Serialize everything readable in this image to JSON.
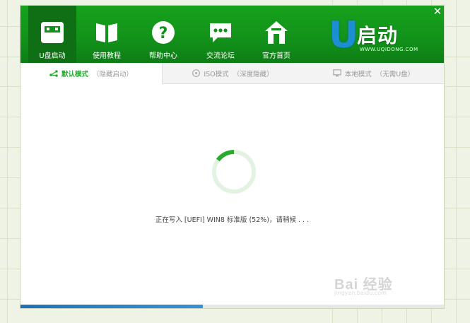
{
  "window": {
    "close_label": "✕"
  },
  "nav": [
    {
      "label": "U盘启动",
      "icon": "usb-drive-icon",
      "active": true
    },
    {
      "label": "使用教程",
      "icon": "book-icon",
      "active": false
    },
    {
      "label": "帮助中心",
      "icon": "question-icon",
      "active": false
    },
    {
      "label": "交流论坛",
      "icon": "chat-bubble-icon",
      "active": false
    },
    {
      "label": "官方首页",
      "icon": "home-icon",
      "active": false
    }
  ],
  "logo": {
    "mark": "U",
    "brand": "启动",
    "url": "WWW.UQIDONG.COM"
  },
  "tabs": [
    {
      "main": "默认模式",
      "sub": "（隐藏启动）",
      "icon": "branch-icon",
      "active": true
    },
    {
      "main": "ISO模式",
      "sub": "（深度隐藏）",
      "icon": "disc-icon",
      "active": false
    },
    {
      "main": "本地模式",
      "sub": "（无需U盘）",
      "icon": "monitor-icon",
      "active": false
    }
  ],
  "status": {
    "text": "正在写入 [UEFI] WIN8 标准版 (52%)，请稍候 . . ."
  },
  "progress": {
    "percent": 0.43
  },
  "watermark": {
    "text": "Bai 经验",
    "url": "jingyan.baidu.com"
  },
  "colors": {
    "header_green": "#12911a",
    "accent_green": "#2aa82f",
    "progress_blue": "#2a80c8"
  }
}
